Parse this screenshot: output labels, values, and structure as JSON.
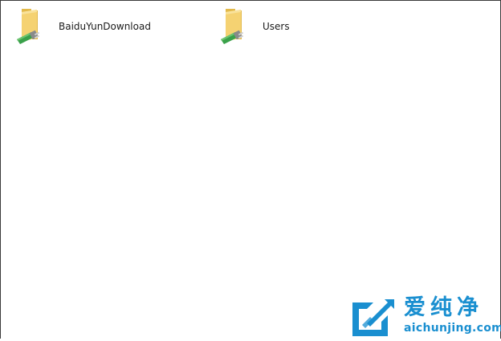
{
  "items": [
    {
      "label": "BaiduYunDownload",
      "icon": "shared-folder-icon"
    },
    {
      "label": "Users",
      "icon": "shared-folder-icon"
    }
  ],
  "watermark": {
    "cn": "爱纯净",
    "url": "aichunjing.com"
  },
  "colors": {
    "folder": "#f5d272",
    "folder_shade": "#e2b94a",
    "share_green": "#3aa14a",
    "watermark": "#1a8fd0"
  }
}
